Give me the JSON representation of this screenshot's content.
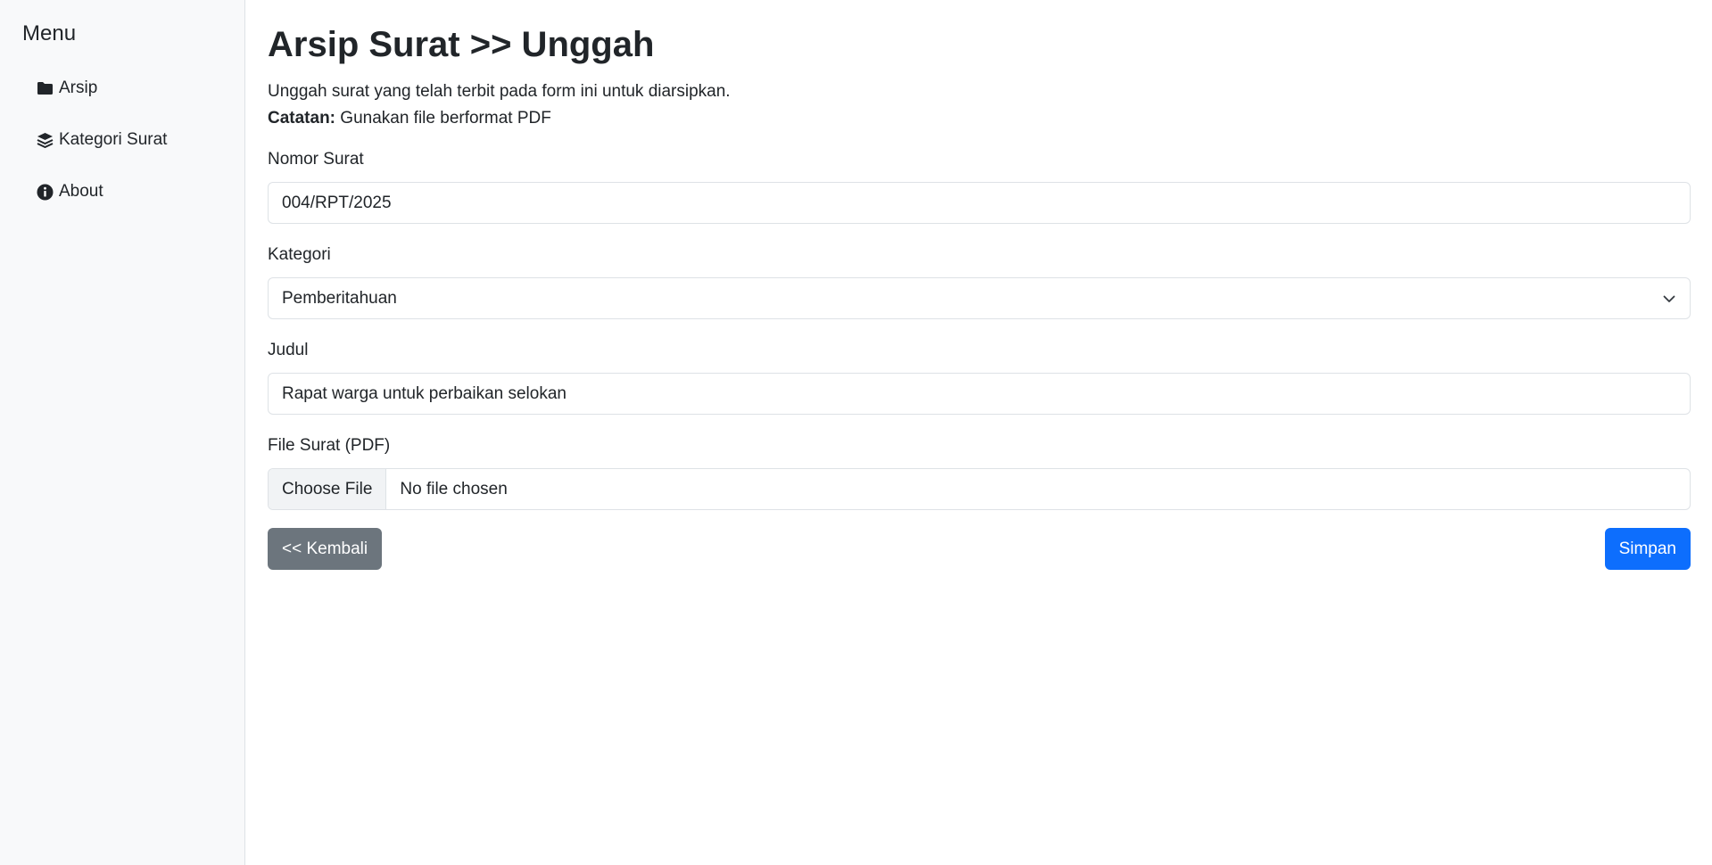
{
  "sidebar": {
    "title": "Menu",
    "items": [
      {
        "label": "Arsip",
        "icon": "folder-icon"
      },
      {
        "label": "Kategori Surat",
        "icon": "layers-icon"
      },
      {
        "label": "About",
        "icon": "info-icon"
      }
    ]
  },
  "main": {
    "title": "Arsip Surat >> Unggah",
    "description": "Unggah surat yang telah terbit pada form ini untuk diarsipkan.",
    "note_label": "Catatan:",
    "note_text": " Gunakan file berformat PDF",
    "form": {
      "nomor_label": "Nomor Surat",
      "nomor_value": "004/RPT/2025",
      "kategori_label": "Kategori",
      "kategori_value": "Pemberitahuan",
      "judul_label": "Judul",
      "judul_value": "Rapat warga untuk perbaikan selokan",
      "file_label": "File Surat (PDF)",
      "file_button": "Choose File",
      "file_status": "No file chosen"
    },
    "buttons": {
      "back": "<< Kembali",
      "save": "Simpan"
    }
  },
  "colors": {
    "primary": "#0d6efd",
    "secondary": "#6c757d",
    "sidebar_bg": "#f8f9fa"
  }
}
